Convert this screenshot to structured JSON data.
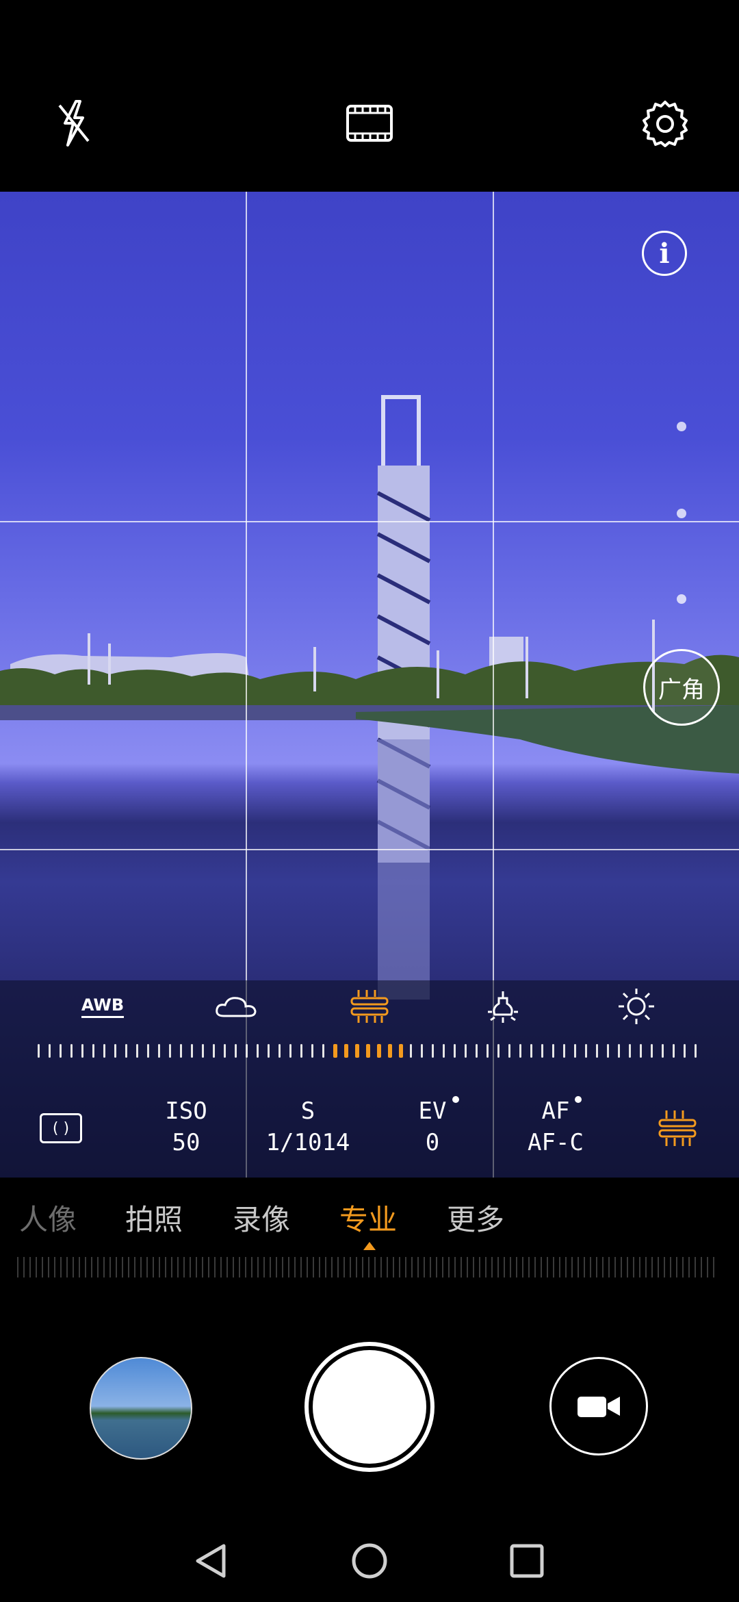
{
  "top_bar": {
    "icons": [
      "flash-off-icon",
      "aspect-ratio-icon",
      "settings-icon"
    ]
  },
  "viewfinder": {
    "info_icon": "info-icon",
    "zoom_label": "广角"
  },
  "white_balance": {
    "awb_label": "AWB",
    "presets": [
      "cloudy-icon",
      "fluorescent-icon",
      "incandescent-icon",
      "daylight-icon"
    ],
    "selected": "fluorescent-icon",
    "accent_color": "#f39a1e"
  },
  "pro_params": {
    "metering_icon": "metering-icon",
    "iso": {
      "label": "ISO",
      "value": "50"
    },
    "shutter": {
      "label": "S",
      "value": "1/1014"
    },
    "ev": {
      "label": "EV",
      "value": "0"
    },
    "af": {
      "label": "AF",
      "value": "AF-C"
    },
    "wb_icon": "fluorescent-icon"
  },
  "modes": {
    "items": [
      "人像",
      "拍照",
      "录像",
      "专业",
      "更多"
    ],
    "active": "专业"
  },
  "bottom": {
    "gallery": "gallery-thumbnail",
    "shutter": "shutter-button",
    "video": "video-camera-icon"
  },
  "nav_bar": [
    "back-icon",
    "home-icon",
    "recents-icon"
  ]
}
